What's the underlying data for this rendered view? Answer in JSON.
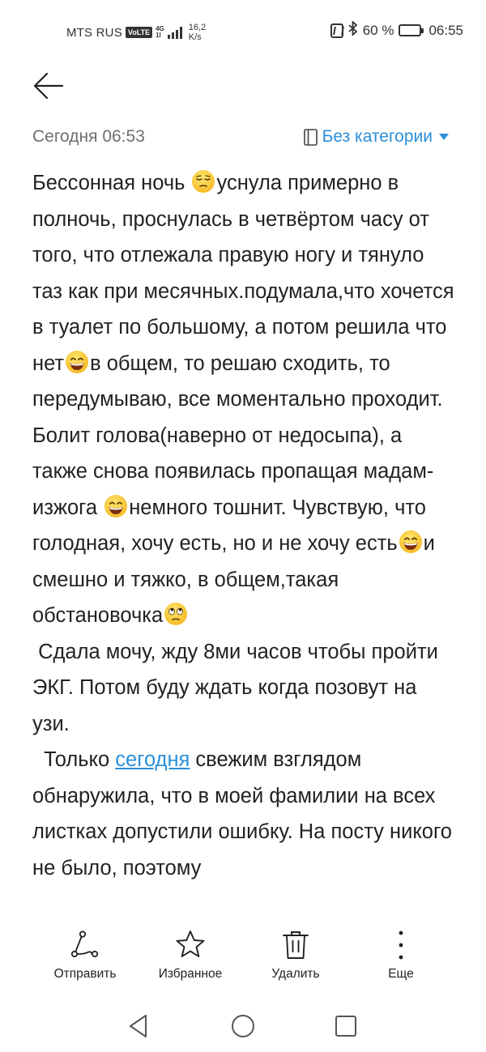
{
  "status_bar": {
    "carrier": "MTS RUS",
    "volte": "VoLTE",
    "network_top": "4G",
    "network_bottom": "1l",
    "speed_value": "16,2",
    "speed_unit": "K/s",
    "battery_text": "60 %",
    "battery_level": 0.6,
    "time": "06:55"
  },
  "header": {
    "date": "Сегодня 06:53",
    "category": "Без категории"
  },
  "note": {
    "p1_a": "Бессонная ночь ",
    "p1_b": "уснула примерно в полночь, проснулась в четвёртом часу от того, что отлежала правую ногу и тянуло таз как при месячных.подумала,что хочется в туалет по большому, а потом решила что нет",
    "p1_c": "в общем, то решаю сходить, то передумываю, все моментально проходит. Болит голова(наверно от недосыпа), а также снова появилась пропащая мадам-изжога ",
    "p1_d": "немного тошнит. Чувствую, что голодная, хочу есть, но и не хочу есть",
    "p1_e": "и смешно и тяжко, в общем,такая обстановочка",
    "p2": " Сдала мочу, жду 8ми часов чтобы пройти ЭКГ. Потом буду ждать когда позовут на узи.",
    "p3_a": "  Только ",
    "p3_link": "сегодня",
    "p3_b": " свежим взглядом обнаружила, что в моей фамилии на всех листках допустили ошибку. На посту никого не было, поэтому"
  },
  "toolbar": {
    "send": "Отправить",
    "favorite": "Избранное",
    "delete": "Удалить",
    "more": "Еще"
  },
  "colors": {
    "accent": "#2a8fd8",
    "text": "#222222",
    "muted": "#6e6e6e"
  }
}
